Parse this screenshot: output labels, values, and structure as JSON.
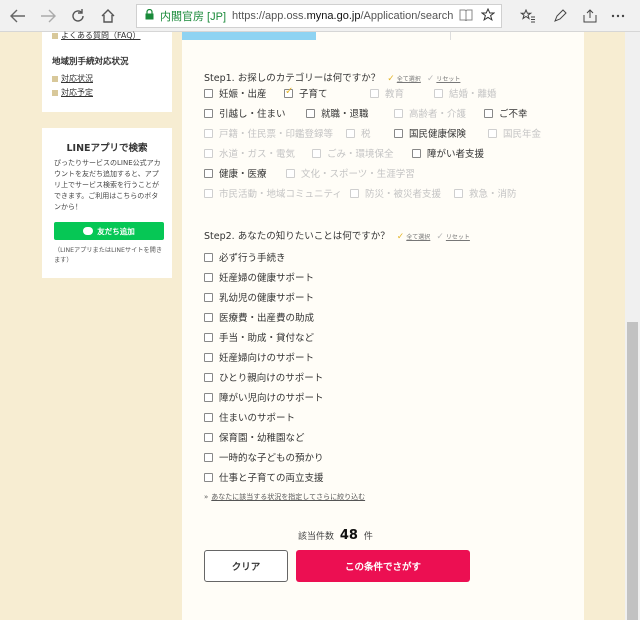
{
  "browser": {
    "site_name": "内閣官房 [JP]",
    "url_prefix": "https://app.oss.",
    "url_domain": "myna.go.jp",
    "url_path": "/Application/search"
  },
  "sidebar": {
    "faq_link": "よくある質問（FAQ）",
    "region_heading": "地域別手続対応状況",
    "status_links": [
      "対応状況",
      "対応予定"
    ],
    "line_heading": "LINEアプリで検索",
    "line_desc": "ぴったりサービスのLINE公式アカウントを友だち追加すると、アプリ上でサービス検索を行うことができます。ご利用はこちらのボタンから！",
    "line_button": "友だち追加",
    "line_note": "（LINEアプリまたはLINEサイトを開きます）"
  },
  "step1": {
    "label": "Step1. お探しのカテゴリーは何ですか？",
    "select_all": "全て選択",
    "reset": "リセット",
    "options": [
      {
        "label": "妊娠・出産",
        "checked": false,
        "disabled": false
      },
      {
        "label": "子育て",
        "checked": true,
        "disabled": false
      },
      {
        "label": "教育",
        "checked": false,
        "disabled": true
      },
      {
        "label": "結婚・離婚",
        "checked": false,
        "disabled": true
      },
      {
        "label": "引越し・住まい",
        "checked": false,
        "disabled": false
      },
      {
        "label": "就職・退職",
        "checked": false,
        "disabled": false
      },
      {
        "label": "高齢者・介護",
        "checked": false,
        "disabled": true
      },
      {
        "label": "ご不幸",
        "checked": false,
        "disabled": false
      },
      {
        "label": "戸籍・住民票・印鑑登録等",
        "checked": false,
        "disabled": true
      },
      {
        "label": "税",
        "checked": false,
        "disabled": true
      },
      {
        "label": "国民健康保険",
        "checked": false,
        "disabled": false
      },
      {
        "label": "国民年金",
        "checked": false,
        "disabled": true
      },
      {
        "label": "水道・ガス・電気",
        "checked": false,
        "disabled": true
      },
      {
        "label": "ごみ・環境保全",
        "checked": false,
        "disabled": true
      },
      {
        "label": "障がい者支援",
        "checked": false,
        "disabled": false
      },
      {
        "label": "健康・医療",
        "checked": false,
        "disabled": false
      },
      {
        "label": "文化・スポーツ・生涯学習",
        "checked": false,
        "disabled": true
      },
      {
        "label": "市民活動・地域コミュニティ",
        "checked": false,
        "disabled": true
      },
      {
        "label": "防災・被災者支援",
        "checked": false,
        "disabled": true
      },
      {
        "label": "救急・消防",
        "checked": false,
        "disabled": true
      }
    ]
  },
  "step2": {
    "label": "Step2. あなたの知りたいことは何ですか？",
    "select_all": "全て選択",
    "reset": "リセット",
    "options": [
      "必ず行う手続き",
      "妊産婦の健康サポート",
      "乳幼児の健康サポート",
      "医療費・出産費の助成",
      "手当・助成・貸付など",
      "妊産婦向けのサポート",
      "ひとり親向けのサポート",
      "障がい児向けのサポート",
      "住まいのサポート",
      "保育園・幼稚園など",
      "一時的な子どもの預かり",
      "仕事と子育ての両立支援"
    ]
  },
  "narrow_link": "あなたに該当する状況を指定してさらに絞り込む",
  "result": {
    "prefix": "該当件数",
    "count": "48",
    "suffix": "件"
  },
  "buttons": {
    "clear": "クリア",
    "search": "この条件でさがす"
  }
}
